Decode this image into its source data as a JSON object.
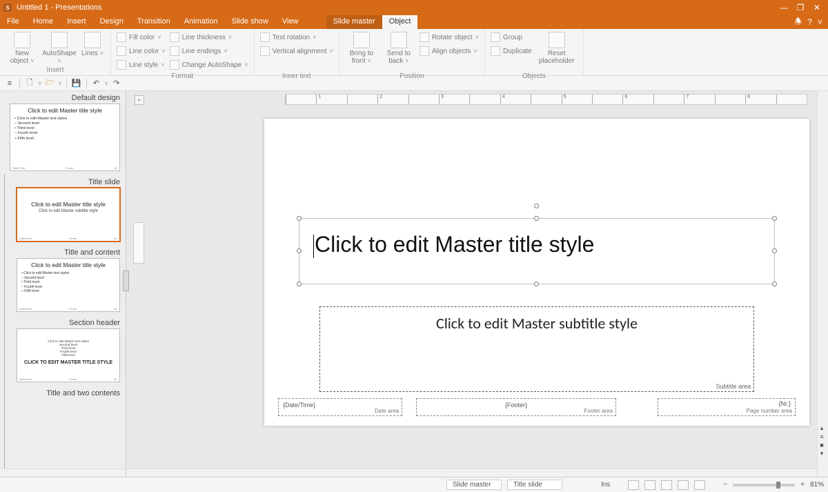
{
  "title": "Untitled 1 - Presentations",
  "window_buttons": {
    "min": "—",
    "max": "❐",
    "close": "✕"
  },
  "menu": [
    "File",
    "Home",
    "Insert",
    "Design",
    "Transition",
    "Animation",
    "Slide show",
    "View"
  ],
  "menu_context": [
    "Slide master",
    "Object"
  ],
  "menu_active": "Object",
  "help_icons": {
    "bell": "🕭",
    "help": "?",
    "chev": "˅"
  },
  "ribbon": {
    "insert": {
      "label": "Insert",
      "new_object": "New object",
      "autoshape": "AutoShape",
      "lines": "Lines"
    },
    "format": {
      "label": "Format",
      "fill_color": "Fill color",
      "line_color": "Line color",
      "line_style": "Line style",
      "line_thickness": "Line thickness",
      "line_endings": "Line endings",
      "change_autoshape": "Change AutoShape"
    },
    "inner_text": {
      "label": "Inner text",
      "text_rotation": "Text rotation",
      "vertical_alignment": "Vertical alignment"
    },
    "position": {
      "label": "Position",
      "bring_front": "Bring to front",
      "send_back": "Send to back",
      "rotate": "Rotate object",
      "align": "Align objects"
    },
    "objects": {
      "label": "Objects",
      "group": "Group",
      "duplicate": "Duplicate",
      "reset_placeholder": "Reset placeholder"
    }
  },
  "panel": {
    "groups": [
      {
        "label": "Default design",
        "title": "Click to edit Master title style",
        "bullets": "• Click to edit Master text styles\n   – Second level\n      • Third level\n         – Fourth level\n            » Fifth level"
      },
      {
        "label": "Title slide",
        "selected": true,
        "title": "Click to edit Master title style",
        "sub": "Click to edit Master subtitle style"
      },
      {
        "label": "Title and content",
        "title": "Click to edit Master title style",
        "bullets": "• Click to edit Master text styles\n   – Second level\n      • Third level\n         – Fourth level\n            » Fifth level"
      },
      {
        "label": "Section header",
        "sub": "Click to edit Master text styles\nSecond level\nThird level\nFourth level\nFifth level",
        "title": "CLICK TO EDIT MASTER TITLE STYLE"
      },
      {
        "label": "Title and two contents"
      }
    ]
  },
  "ruler_ticks": [
    "",
    "1",
    "",
    "2",
    "",
    "3",
    "",
    "4",
    "",
    "5",
    "",
    "6",
    "",
    "7",
    "",
    "8",
    ""
  ],
  "slide": {
    "title_text": "Click to edit Master title style",
    "subtitle_text": "Click to edit Master subtitle style",
    "subtitle_area_label": "Subtitle area",
    "date_value": "{Date/Time}",
    "date_label": "Date area",
    "footer_value": "{Footer}",
    "footer_label": "Footer area",
    "nr_value": "{Nr.}",
    "nr_label": "Page number area"
  },
  "status": {
    "mode": "Slide master",
    "layout": "Title slide",
    "ins": "Ins",
    "zoom_minus": "−",
    "zoom_plus": "+",
    "zoom": "81%"
  }
}
